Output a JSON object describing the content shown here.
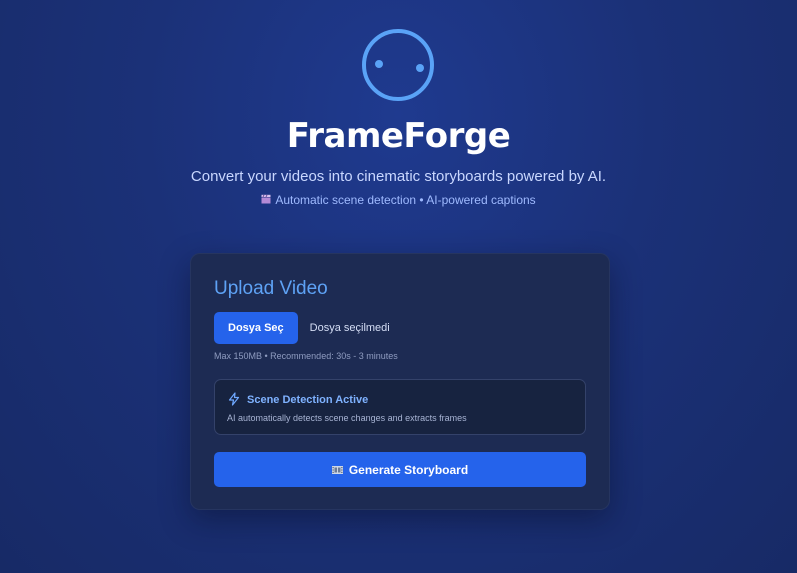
{
  "brand": {
    "logo_icon": "robot-face-icon",
    "name": "FrameForge",
    "tagline": "Convert your videos into cinematic storyboards powered by AI.",
    "features_icon": "clapperboard-icon",
    "features": "Automatic scene detection • AI-powered captions"
  },
  "upload": {
    "title": "Upload Video",
    "choose_file_label": "Dosya Seç",
    "file_status": "Dosya seçilmedi",
    "hint": "Max 150MB • Recommended: 30s - 3 minutes",
    "info": {
      "icon": "lightning-icon",
      "title": "Scene Detection Active",
      "description": "AI automatically detects scene changes and extracts frames"
    },
    "generate_icon": "film-strip-icon",
    "generate_label": "Generate Storyboard"
  },
  "colors": {
    "accent": "#2563eb",
    "accent_text": "#5ea2f5",
    "background": "#1b3178",
    "card": "#1d2b53"
  }
}
